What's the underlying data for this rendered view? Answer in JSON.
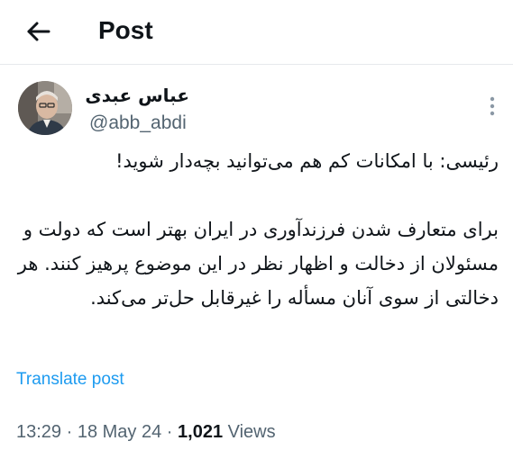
{
  "header": {
    "back_icon": "arrow-left-icon",
    "title": "Post"
  },
  "post": {
    "author": {
      "name": "عباس عبدی",
      "handle": "@abb_abdi",
      "avatar": "user-avatar"
    },
    "more_icon": "vertical-ellipsis-icon",
    "paragraphs": [
      "رئیسی: با امکانات کم هم می‌توانید بچه‌دار شوید!",
      "برای متعارف شدن فرزندآوری در ایران بهتر است که دولت و مسئولان از دخالت و اظهار نظر در این موضوع پرهیز کنند. هر دخالتی از سوی آنان مسأله را غیرقابل حل‌تر می‌کند."
    ],
    "translate_label": "Translate post",
    "meta": {
      "time": "13:29",
      "sep1": " · ",
      "date": "18 May 24",
      "sep2": " · ",
      "views_count": "1,021",
      "views_label": " Views"
    }
  },
  "colors": {
    "text": "#0f1419",
    "secondary": "#536471",
    "link": "#1d9bf0",
    "divider": "#e6e9ec"
  }
}
